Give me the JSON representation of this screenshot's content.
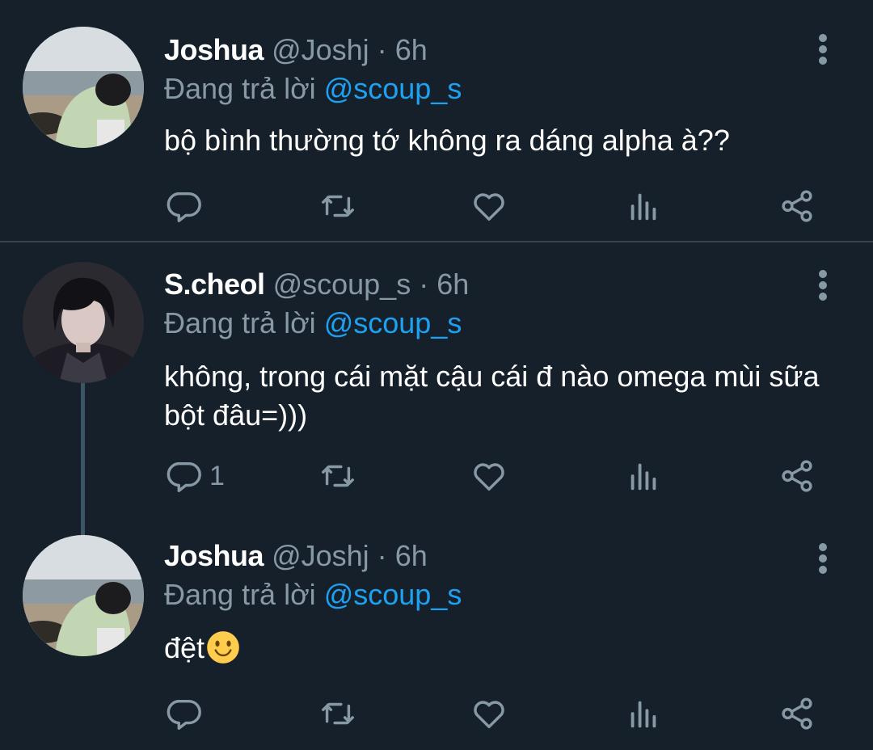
{
  "tweets": [
    {
      "name": "Joshua",
      "handle": "@Joshj",
      "separator": "·",
      "time": "6h",
      "reply_prefix": "Đang trả lời",
      "reply_to": "@scoup_s",
      "text": "bộ bình thường tớ không ra dáng alpha à??",
      "reply_count": ""
    },
    {
      "name": "S.cheol",
      "handle": "@scoup_s",
      "separator": "·",
      "time": "6h",
      "reply_prefix": "Đang trả lời",
      "reply_to": "@scoup_s",
      "text": "không, trong cái mặt cậu cái đ nào omega mùi sữa bột đâu=)))",
      "reply_count": "1"
    },
    {
      "name": "Joshua",
      "handle": "@Joshj",
      "separator": "·",
      "time": "6h",
      "reply_prefix": "Đang trả lời",
      "reply_to": "@scoup_s",
      "text": "đệt",
      "reply_count": ""
    }
  ],
  "icons": {
    "reply": "reply-icon",
    "retweet": "retweet-icon",
    "like": "heart-icon",
    "analytics": "analytics-icon",
    "share": "share-icon",
    "more": "more-vertical-icon",
    "emoji": "slightly-smiling-face-emoji"
  },
  "colors": {
    "background": "#15202b",
    "secondary_text": "#8899a6",
    "mention": "#1da1f2",
    "divider": "#38444d",
    "thread_line": "#3d5466"
  }
}
